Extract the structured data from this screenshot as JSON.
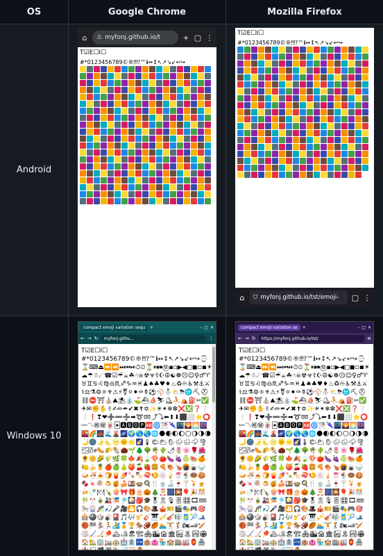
{
  "headers": {
    "os": "OS",
    "chrome": "Google Chrome",
    "firefox": "Mozilla Firefox"
  },
  "rows": {
    "android": "Android",
    "windows": "Windows 10"
  },
  "android_chrome": {
    "url": "myfonj.github.io/t"
  },
  "android_firefox": {
    "url": "myfonj.github.io/tst/emoji-"
  },
  "win_chrome": {
    "tab_title": "compact emoji variation sequ",
    "url": "myfonj.githu..."
  },
  "win_firefox": {
    "tab_title": "compact emoji variation se",
    "url": "https://myfonj.github.io/tst/"
  },
  "emoji_header": "T☑E☐I☐",
  "emoji_row2": "#*0123456789©®‼⁉™ℹ↔↕↖↗↘↙↩↪",
  "emoji_text_win": "#*0123456789©®‼⁉™ℹ↔↕↖↗↘↙↩↪⌚⌛⌨⏏⏩⏪⏭⏮⏯⏱⏲⏳⏸⏹⏺Ⓜ▪▫▶◀◻◼◽◾☀☁☂☃☄☎☑☔☕☘☝☠☢☣☦☪☮☯☸☹☺♀♂♈♉♊♋♌♍♎♏♐♑♒♓♟♠♣♥♦♨♻♾♿⚒⚓⚔⚕⚖⚗⚙⚛⚜⚠⚡⚧⚪⚫⚰⚱⚽⚾⛄⛅⛈⛎⛏⛑⛓⛔⛩⛪⛰⛱⛲⛳⛴⛵⛷⛸⛹⛺⛽✂✅✈✉✊✋✌✍✏✒✔✖✝✡✨✳✴❄❇❌❎❓❔❕❗❣❤➕➖➗➡➰➿⤴⤵⬅⬆⬇⬛⬜⭐⭕〰〽㊗㊙🀄🃏🅰🅱🅾🅿🆎🌀🌁🌂🌃🌄🌅🌆🌇🌈🌉🌊🌋🌌🌍🌎🌏🌐🌑🌒🌓🌔🌕🌖🌗🌘🌙🌚🌛🌜🌝🌞🌟🌠🌡🌤🌥🌦🌧🌨🌩🌪🌫🌬🌭🌮🌯🌰🌱🌲🌳🌴🌵🌶🌷🌸🌹🌺🌻🌼🌽🌾🌿🍀🍁🍂🍃🍄🍅🍆🍇🍈🍉🍊🍋🍌🍍🍎🍏🍐🍑🍒🍓🍔🍕🍖🍗🍘🍙🍚🍛🍜🍝🍞🍟🍠🍡🍢🍣🍤🍥🍦🍧🍨🍩🍪🍫🍬🍭🍮🍯🍰🍱🍲🍳🍴🍵🍶🍷🍸🍹🍺🍻🍼🍽🍾🍿🎀🎁🎂🎃🎄🎅🎆🎇🎈🎉🎊🎋🎌🎍🎎🎏🎐🎑🎒🎓🎖🎗🎙🎚🎛🎞🎟🎠🎡🎢🎣🎤🎥🎦🎧🎨🎩🎪🎫🎬🎭🎮🎯🎰🎱🎲🎳🎴🎵🎶🎷🎸🎹🎺🎻🎼🎽🎾🎿🏀🏁🏂🏃🏄🏅🏆🏇🏈🏉🏊🏋🏌🏍🏎🏏🏐🏑🏒🏓🏔🏕🏖🏗🏘🏙🏚🏛🏜🏝🏞🏟🏠🏡🏢🏣🏤🏥🏦🏧🏨🏩🏪🏫🏬🏭🏮🏯🏰🏳🏴🏵🏷🏸🏹🏺"
}
